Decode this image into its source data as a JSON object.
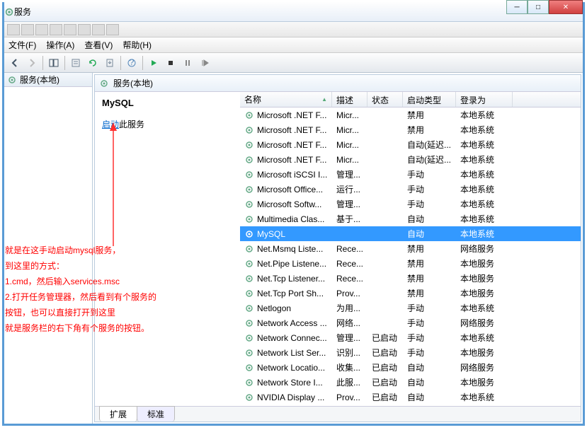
{
  "window": {
    "title": "服务"
  },
  "menubar": {
    "file": "文件(F)",
    "action": "操作(A)",
    "view": "查看(V)",
    "help": "帮助(H)"
  },
  "leftpane": {
    "title": "服务(本地)"
  },
  "rightheader": {
    "title": "服务(本地)"
  },
  "desc": {
    "selected_title": "MySQL",
    "action_link": "启动",
    "action_suffix": "此服务"
  },
  "columns": {
    "name": "名称",
    "desc": "描述",
    "status": "状态",
    "startup": "启动类型",
    "logon": "登录为"
  },
  "tabs": {
    "extended": "扩展",
    "standard": "标准"
  },
  "services": [
    {
      "name": "Microsoft .NET F...",
      "desc": "Micr...",
      "status": "",
      "startup": "禁用",
      "logon": "本地系统"
    },
    {
      "name": "Microsoft .NET F...",
      "desc": "Micr...",
      "status": "",
      "startup": "禁用",
      "logon": "本地系统"
    },
    {
      "name": "Microsoft .NET F...",
      "desc": "Micr...",
      "status": "",
      "startup": "自动(延迟...",
      "logon": "本地系统"
    },
    {
      "name": "Microsoft .NET F...",
      "desc": "Micr...",
      "status": "",
      "startup": "自动(延迟...",
      "logon": "本地系统"
    },
    {
      "name": "Microsoft iSCSI I...",
      "desc": "管理...",
      "status": "",
      "startup": "手动",
      "logon": "本地系统"
    },
    {
      "name": "Microsoft Office...",
      "desc": "运行...",
      "status": "",
      "startup": "手动",
      "logon": "本地系统"
    },
    {
      "name": "Microsoft Softw...",
      "desc": "管理...",
      "status": "",
      "startup": "手动",
      "logon": "本地系统"
    },
    {
      "name": "Multimedia Clas...",
      "desc": "基于...",
      "status": "",
      "startup": "自动",
      "logon": "本地系统"
    },
    {
      "name": "MySQL",
      "desc": "",
      "status": "",
      "startup": "自动",
      "logon": "本地系统",
      "selected": true
    },
    {
      "name": "Net.Msmq Liste...",
      "desc": "Rece...",
      "status": "",
      "startup": "禁用",
      "logon": "网络服务"
    },
    {
      "name": "Net.Pipe Listene...",
      "desc": "Rece...",
      "status": "",
      "startup": "禁用",
      "logon": "本地服务"
    },
    {
      "name": "Net.Tcp Listener...",
      "desc": "Rece...",
      "status": "",
      "startup": "禁用",
      "logon": "本地服务"
    },
    {
      "name": "Net.Tcp Port Sh...",
      "desc": "Prov...",
      "status": "",
      "startup": "禁用",
      "logon": "本地服务"
    },
    {
      "name": "Netlogon",
      "desc": "为用...",
      "status": "",
      "startup": "手动",
      "logon": "本地系统"
    },
    {
      "name": "Network Access ...",
      "desc": "网络...",
      "status": "",
      "startup": "手动",
      "logon": "网络服务"
    },
    {
      "name": "Network Connec...",
      "desc": "管理...",
      "status": "已启动",
      "startup": "手动",
      "logon": "本地系统"
    },
    {
      "name": "Network List Ser...",
      "desc": "识别...",
      "status": "已启动",
      "startup": "手动",
      "logon": "本地服务"
    },
    {
      "name": "Network Locatio...",
      "desc": "收集...",
      "status": "已启动",
      "startup": "自动",
      "logon": "网络服务"
    },
    {
      "name": "Network Store I...",
      "desc": "此服...",
      "status": "已启动",
      "startup": "自动",
      "logon": "本地服务"
    },
    {
      "name": "NVIDIA Display ...",
      "desc": "Prov...",
      "status": "已启动",
      "startup": "自动",
      "logon": "本地系统"
    }
  ],
  "annotation": {
    "line1": "就是在这手动启动mysql服务，",
    "line2": "到这里的方式：",
    "line3": "1.cmd，然后输入services.msc",
    "line4": "2.打开任务管理器，然后看到有个服务的",
    "line5": "按钮，也可以直接打开到这里",
    "line6": "  就是服务栏的右下角有个服务的按钮。"
  }
}
